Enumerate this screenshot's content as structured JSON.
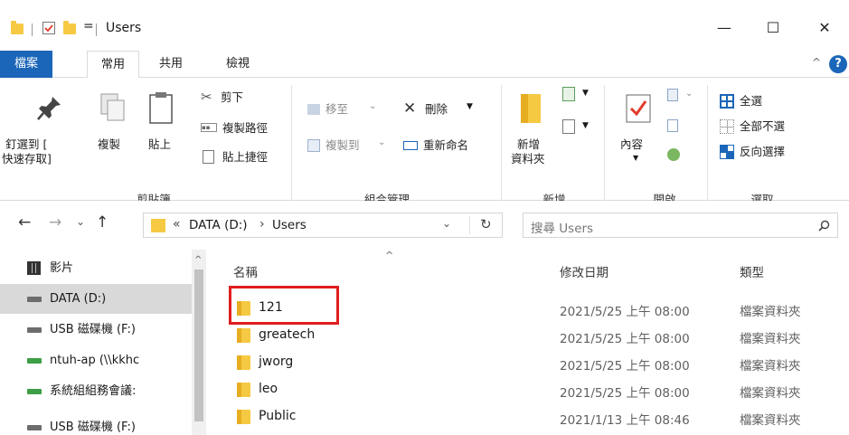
{
  "titlebar": {
    "title": "Users",
    "qat_dropdown": "=",
    "minimize": "—",
    "maximize": "☐",
    "close": "✕"
  },
  "tabs": {
    "file": "檔案",
    "home": "常用",
    "share": "共用",
    "view": "檢視",
    "help": "?"
  },
  "ribbon": {
    "clipboard": {
      "pin_line1": "釘選到 [",
      "pin_line2": "快速存取]",
      "copy": "複製",
      "paste": "貼上",
      "cut": "剪下",
      "copy_path": "複製路徑",
      "paste_shortcut": "貼上捷徑",
      "group": "剪貼簿"
    },
    "organize": {
      "move_to": "移至",
      "copy_to": "複製到",
      "delete": "刪除",
      "rename": "重新命名",
      "group": "組合管理"
    },
    "new": {
      "new_folder_line1": "新增",
      "new_folder_line2": "資料夾",
      "group": "新增"
    },
    "open": {
      "properties": "內容",
      "group": "開啟"
    },
    "select": {
      "select_all": "全選",
      "select_none": "全部不選",
      "invert": "反向選擇",
      "group": "選取"
    }
  },
  "address": {
    "path_prefix": "«",
    "segment1": "DATA (D:)",
    "chevron": "›",
    "segment2": "Users",
    "search_placeholder": "搜尋 Users"
  },
  "nav": {
    "items": [
      {
        "label": "影片"
      },
      {
        "label": "DATA (D:)"
      },
      {
        "label": "USB 磁碟機 (F:)"
      },
      {
        "label": "ntuh-ap (\\\\kkhc"
      },
      {
        "label": "系統組組務會議:"
      },
      {
        "label": "USB 磁碟機 (F:)"
      }
    ]
  },
  "list": {
    "columns": {
      "name": "名稱",
      "date": "修改日期",
      "type": "類型"
    },
    "rows": [
      {
        "name": "121",
        "date": "2021/5/25 上午 08:00",
        "type": "檔案資料夾"
      },
      {
        "name": "greatech",
        "date": "2021/5/25 上午 08:00",
        "type": "檔案資料夾"
      },
      {
        "name": "jworg",
        "date": "2021/5/25 上午 08:00",
        "type": "檔案資料夾"
      },
      {
        "name": "leo",
        "date": "2021/5/25 上午 08:00",
        "type": "檔案資料夾"
      },
      {
        "name": "Public",
        "date": "2021/1/13 上午 08:46",
        "type": "檔案資料夾"
      }
    ]
  },
  "colors": {
    "file_tab": "#1b66b8",
    "folder": "#f6c943",
    "highlight_box": "#e01e1e",
    "nav_selected": "#d9d9d9"
  }
}
